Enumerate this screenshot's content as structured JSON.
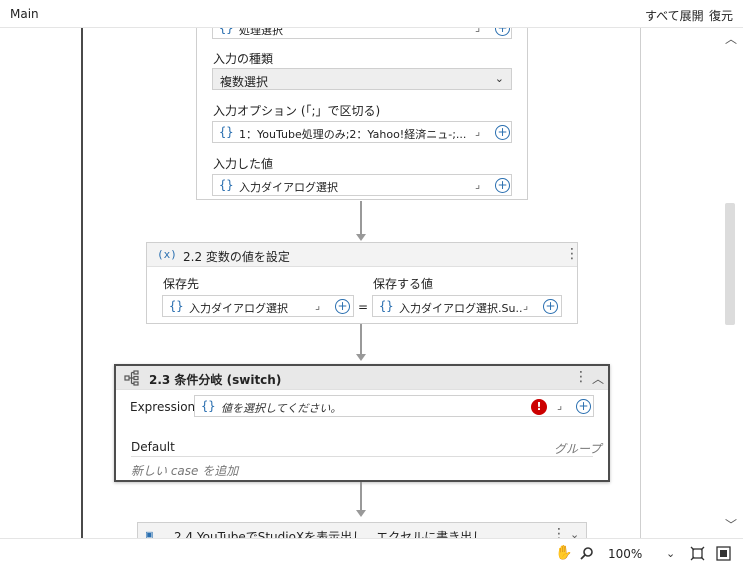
{
  "topbar": {
    "title": "Main",
    "expand_all": "すべて展開",
    "restore": "復元"
  },
  "input_card": {
    "first_field_value": "処理選択",
    "type_label": "入力の種類",
    "type_value": "複数選択",
    "options_label": "入力オプション (「;」で区切る)",
    "options_value": "1：YouTube処理のみ;2：Yahoo!経済ニュ-;...",
    "result_label": "入力した値",
    "result_value": "入力ダイアログ選択"
  },
  "assign_card": {
    "icon": "(x)",
    "title": "2.2 変数の値を設定",
    "to_label": "保存先",
    "to_value": "入力ダイアログ選択",
    "equals": "=",
    "value_label": "保存する値",
    "value_value": "入力ダイアログ選択.Su..."
  },
  "switch_card": {
    "title": "2.3 条件分岐 (switch)",
    "expression_label": "Expression",
    "expression_placeholder": "値を選択してください。",
    "default_label": "Default",
    "group_label": "グループ",
    "add_case": "新しい case を追加"
  },
  "next_card": {
    "title": "2.4 YouTubeでStudioXを表示出し、エクセルに書き出し"
  },
  "statusbar": {
    "zoom": "100%"
  },
  "colors": {
    "accent": "#2a6fb0",
    "error": "#cc0000",
    "frame": "#4a4a4a"
  }
}
